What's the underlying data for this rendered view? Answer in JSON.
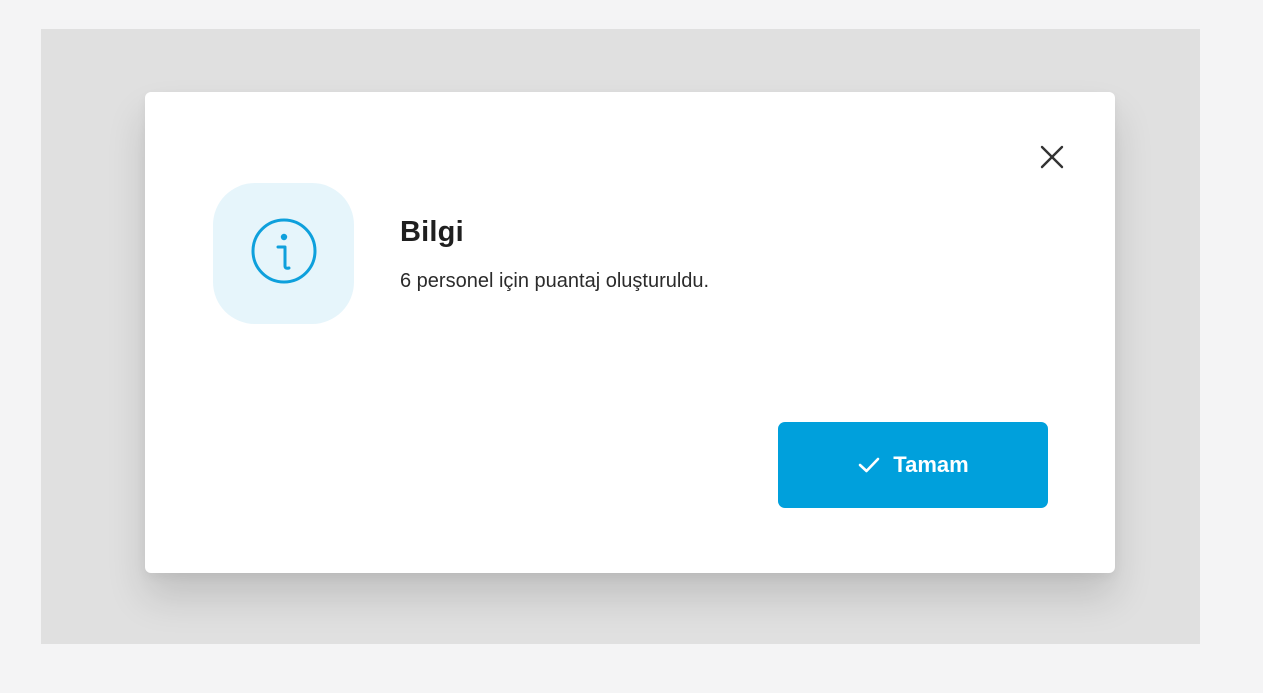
{
  "dialog": {
    "title": "Bilgi",
    "message": "6 personel için puantaj oluşturuldu.",
    "icon": "info-icon",
    "close_icon": "close-icon",
    "ok_button": {
      "label": "Tamam",
      "icon": "check-icon"
    }
  },
  "colors": {
    "accent": "#00a0dc",
    "icon_bg": "#e6f5fb",
    "overlay": "#e0e0e0"
  }
}
